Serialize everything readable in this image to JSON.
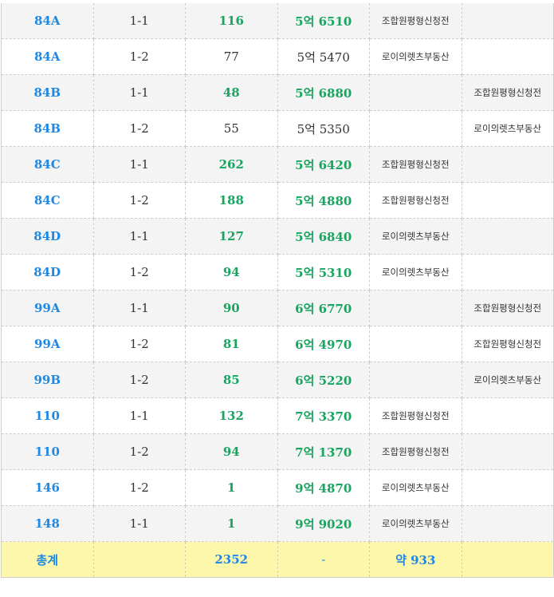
{
  "rows": [
    {
      "type": "84A",
      "dong": "1-1",
      "count": "116",
      "price": "5억 6510",
      "agent1": "조합원평형신청전",
      "agent2": "",
      "hl": true
    },
    {
      "type": "84A",
      "dong": "1-2",
      "count": "77",
      "price": "5억 5470",
      "agent1": "로이의렛츠부동산",
      "agent2": "",
      "hl": false
    },
    {
      "type": "84B",
      "dong": "1-1",
      "count": "48",
      "price": "5억 6880",
      "agent1": "",
      "agent2": "조합원평형신청전",
      "hl": true
    },
    {
      "type": "84B",
      "dong": "1-2",
      "count": "55",
      "price": "5억 5350",
      "agent1": "",
      "agent2": "로이의렛츠부동산",
      "hl": false
    },
    {
      "type": "84C",
      "dong": "1-1",
      "count": "262",
      "price": "5억 6420",
      "agent1": "조합원평형신청전",
      "agent2": "",
      "hl": true
    },
    {
      "type": "84C",
      "dong": "1-2",
      "count": "188",
      "price": "5억 4880",
      "agent1": "조합원평형신청전",
      "agent2": "",
      "hl": true
    },
    {
      "type": "84D",
      "dong": "1-1",
      "count": "127",
      "price": "5억 6840",
      "agent1": "로이의렛츠부동산",
      "agent2": "",
      "hl": true
    },
    {
      "type": "84D",
      "dong": "1-2",
      "count": "94",
      "price": "5억 5310",
      "agent1": "로이의렛츠부동산",
      "agent2": "",
      "hl": true
    },
    {
      "type": "99A",
      "dong": "1-1",
      "count": "90",
      "price": "6억 6770",
      "agent1": "",
      "agent2": "조합원평형신청전",
      "hl": true
    },
    {
      "type": "99A",
      "dong": "1-2",
      "count": "81",
      "price": "6억 4970",
      "agent1": "",
      "agent2": "조합원평형신청전",
      "hl": true
    },
    {
      "type": "99B",
      "dong": "1-2",
      "count": "85",
      "price": "6억 5220",
      "agent1": "",
      "agent2": "로이의렛츠부동산",
      "hl": true
    },
    {
      "type": "110",
      "dong": "1-1",
      "count": "132",
      "price": "7억 3370",
      "agent1": "조합원평형신청전",
      "agent2": "",
      "hl": true
    },
    {
      "type": "110",
      "dong": "1-2",
      "count": "94",
      "price": "7억 1370",
      "agent1": "조합원평형신청전",
      "agent2": "",
      "hl": true
    },
    {
      "type": "146",
      "dong": "1-2",
      "count": "1",
      "price": "9억 4870",
      "agent1": "로이의렛츠부동산",
      "agent2": "",
      "hl": true
    },
    {
      "type": "148",
      "dong": "1-1",
      "count": "1",
      "price": "9억 9020",
      "agent1": "로이의렛츠부동산",
      "agent2": "",
      "hl": true
    }
  ],
  "total": {
    "label": "총계",
    "dong": "",
    "count": "2352",
    "price": "-",
    "agent1": "약 933",
    "agent2": ""
  },
  "colors": {
    "type_blue": "#1e88e5",
    "value_green": "#17a55f",
    "total_bg": "#fdf7ab",
    "shade_bg": "#f4f4f4"
  }
}
